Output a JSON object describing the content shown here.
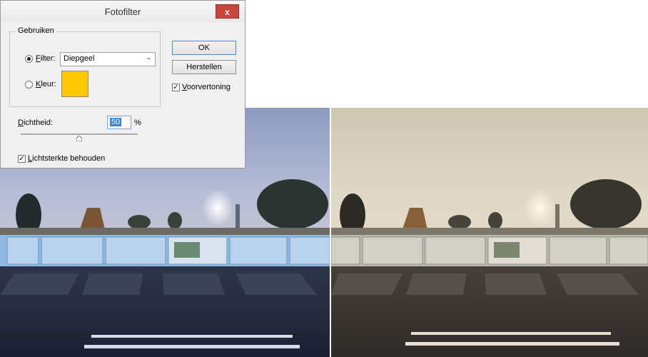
{
  "dialog": {
    "title": "Fotofilter",
    "close_label": "x",
    "group_label": "Gebruiken",
    "filter": {
      "label": "Filter:",
      "underline": "F",
      "rest": "ilter:",
      "selected": "Diepgeel",
      "checked": true
    },
    "color": {
      "label": "Kleur:",
      "underline": "K",
      "rest": "leur:",
      "swatch": "#ffc800",
      "checked": false
    },
    "buttons": {
      "ok": "OK",
      "reset": "Herstellen"
    },
    "preview": {
      "underline": "V",
      "rest": "oorvertoning",
      "checked": true
    },
    "density": {
      "underline": "D",
      "rest": "ichtheid:",
      "value": "50",
      "unit": "%",
      "level": 0.5
    },
    "preserve": {
      "underline": "L",
      "rest": "ichtsterkte behouden",
      "checked": true
    }
  },
  "colors": {
    "left_sky": "#aab4cf",
    "right_sky": "#d8d1bf",
    "banner": "#8fb9e0"
  }
}
